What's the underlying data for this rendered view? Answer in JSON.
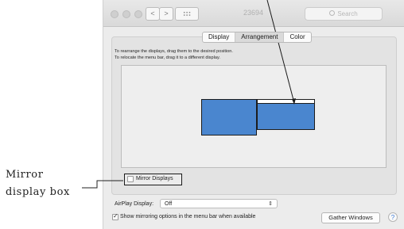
{
  "window": {
    "title": "23694",
    "search_placeholder": "Search",
    "nav_back": "<",
    "nav_forward": ">"
  },
  "tabs": [
    {
      "label": "Display",
      "active": false
    },
    {
      "label": "Arrangement",
      "active": true
    },
    {
      "label": "Color",
      "active": false
    }
  ],
  "instructions": {
    "line1": "To rearrange the displays, drag them to the desired position.",
    "line2": "To relocate the menu bar, drag it to a different display."
  },
  "mirror": {
    "label": "Mirror Displays",
    "checked": false
  },
  "airplay": {
    "label": "AirPlay Display:",
    "value": "Off"
  },
  "show_mirroring": {
    "label": "Show mirroring options in the menu bar when available",
    "checked": true
  },
  "buttons": {
    "gather": "Gather Windows",
    "help": "?"
  },
  "annotation": {
    "line1": "Mirror",
    "line2": "display box"
  },
  "colors": {
    "display_blue": "#4a86cf",
    "accent": "#3a78d6"
  }
}
